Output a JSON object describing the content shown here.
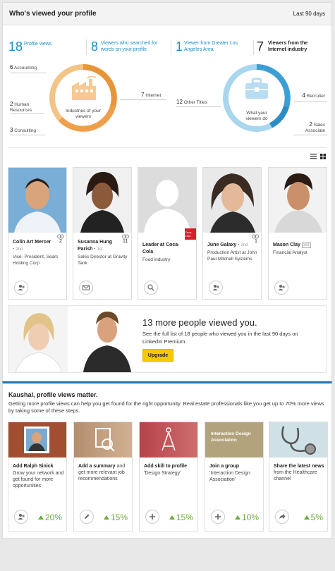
{
  "header": {
    "title": "Who's viewed your profile",
    "range": "Last 90 days"
  },
  "stats": [
    {
      "num": "18",
      "text": "Profile views",
      "active": false
    },
    {
      "num": "8",
      "text": "Viewers who searched for words on your profile",
      "active": false
    },
    {
      "num": "1",
      "text": "Viewer from Greater Los Angeles Area",
      "active": false
    },
    {
      "num": "7",
      "text": "Viewers from the Internet industry",
      "active": true
    }
  ],
  "industries": {
    "center": "Industries of your viewers",
    "left": [
      {
        "num": "6",
        "label": "Accounting"
      },
      {
        "num": "2",
        "label": "Human Resources"
      },
      {
        "num": "3",
        "label": "Consulting"
      }
    ],
    "right": {
      "num": "7",
      "label": "Internet"
    }
  },
  "titles": {
    "center": "What your viewers do",
    "left": {
      "num": "12",
      "label": "Other Titles"
    },
    "right": [
      {
        "num": "4",
        "label": "Recruiter"
      },
      {
        "num": "2",
        "label": "Sales Associate"
      }
    ]
  },
  "viewers": [
    {
      "name": "Colin Art Mercer",
      "degree": "2nd",
      "headline": "Vice- President, Sears Holding Corp",
      "count": "2",
      "action": "connect"
    },
    {
      "name": "Susanna Hung Parish",
      "degree": "1st",
      "headline": "Sales Director at Gravity Tank",
      "count": "11",
      "action": "message"
    },
    {
      "name": "Leader at Coca-Cola",
      "degree": "",
      "headline": "Food industry",
      "count": "",
      "action": "search",
      "badge": "Coca-Cola"
    },
    {
      "name": "June Galaxy",
      "degree": "2nd",
      "headline": "Production Artist at John Paul Mitchell Systems",
      "count": "1",
      "action": "connect"
    },
    {
      "name": "Mason Clay",
      "degree": "3rd",
      "headline": "Financial Analyst",
      "count": "",
      "action": "connect"
    }
  ],
  "premium": {
    "title": "13 more people viewed you.",
    "text": "See the full list of 18 people who viewed you in the last 90 days on LinkedIn Premium.",
    "button": "Upgrade"
  },
  "tips": {
    "title": "Kaushal, profile views matter.",
    "text": "Getting more profile views can help you get found for the right opportunity. Real estate professionals like you get up to 70% more views by taking some of these steps.",
    "cards": [
      {
        "title": "Add Ralph Sinick",
        "text": "Grow your network and get found for more opportunities",
        "pct": "20%",
        "action": "connect"
      },
      {
        "title": "Add a summary",
        "text": "and get more relevant job recommendations",
        "pct": "15%",
        "action": "edit"
      },
      {
        "title": "Add skill to profile",
        "text": "'Design Strategy'",
        "pct": "15%",
        "action": "add"
      },
      {
        "title": "Join a group",
        "text": "'Interaction Design Association'",
        "pct": "10%",
        "action": "add",
        "image_text": "Interaction Design Association"
      },
      {
        "title": "Share the latest news",
        "text": "from the Healthcare channel",
        "pct": "5%",
        "action": "share"
      }
    ]
  },
  "colors": {
    "accent": "#1a8fc9",
    "orange": "#e8953a",
    "blue": "#4aa8d8",
    "green": "#6aab3a",
    "upgrade": "#f5c800"
  }
}
